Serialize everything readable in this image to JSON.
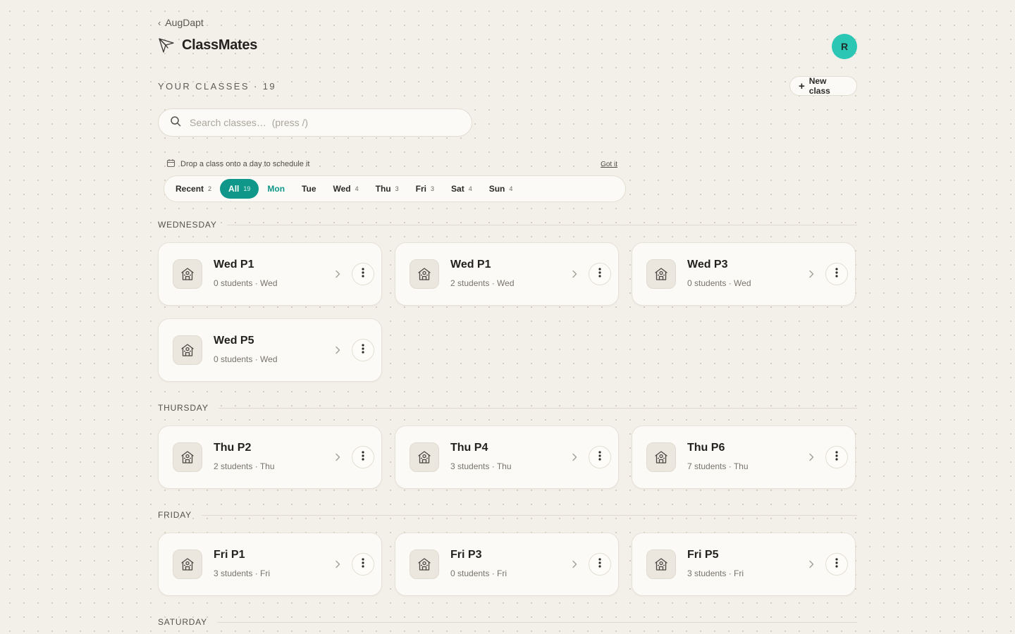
{
  "nav": {
    "back_label": "AugDapt",
    "brand_name": "ClassMates",
    "avatar_initial": "R"
  },
  "header": {
    "section_title": "YOUR CLASSES",
    "separator": "·",
    "count": "19",
    "new_class_label": "New class"
  },
  "search": {
    "placeholder": "Search classes…  (press /)",
    "value": ""
  },
  "hint": {
    "text": "Drop a class onto a day to schedule it",
    "dismiss_label": "Got it"
  },
  "day_filter": [
    {
      "label": "Recent",
      "count": "2"
    },
    {
      "label": "All",
      "count": "19",
      "active": true
    },
    {
      "label": "Mon",
      "count": "",
      "today": true
    },
    {
      "label": "Tue",
      "count": ""
    },
    {
      "label": "Wed",
      "count": "4"
    },
    {
      "label": "Thu",
      "count": "3"
    },
    {
      "label": "Fri",
      "count": "3"
    },
    {
      "label": "Sat",
      "count": "4"
    },
    {
      "label": "Sun",
      "count": "4"
    }
  ],
  "groups": [
    {
      "label": "WEDNESDAY"
    },
    {
      "label": "THURSDAY"
    },
    {
      "label": "FRIDAY"
    },
    {
      "label": "SATURDAY"
    }
  ],
  "classes": [
    {
      "name": "Wed P1",
      "meta": "0 students · Wed"
    },
    {
      "name": "Wed P1",
      "meta": "2 students · Wed"
    },
    {
      "name": "Wed P3",
      "meta": "0 students · Wed"
    },
    {
      "name": "Wed P5",
      "meta": "0 students · Wed"
    },
    {
      "name": "Thu P2",
      "meta": "2 students · Thu"
    },
    {
      "name": "Thu P4",
      "meta": "3 students · Thu"
    },
    {
      "name": "Thu P6",
      "meta": "7 students · Thu"
    },
    {
      "name": "Fri P1",
      "meta": "3 students · Fri"
    },
    {
      "name": "Fri P3",
      "meta": "0 students · Fri"
    },
    {
      "name": "Fri P5",
      "meta": "3 students · Fri"
    }
  ],
  "colors": {
    "accent": "#0f978a",
    "avatar": "#2cc7b4",
    "background": "#f3f0e9",
    "card": "#fbfaf6"
  }
}
